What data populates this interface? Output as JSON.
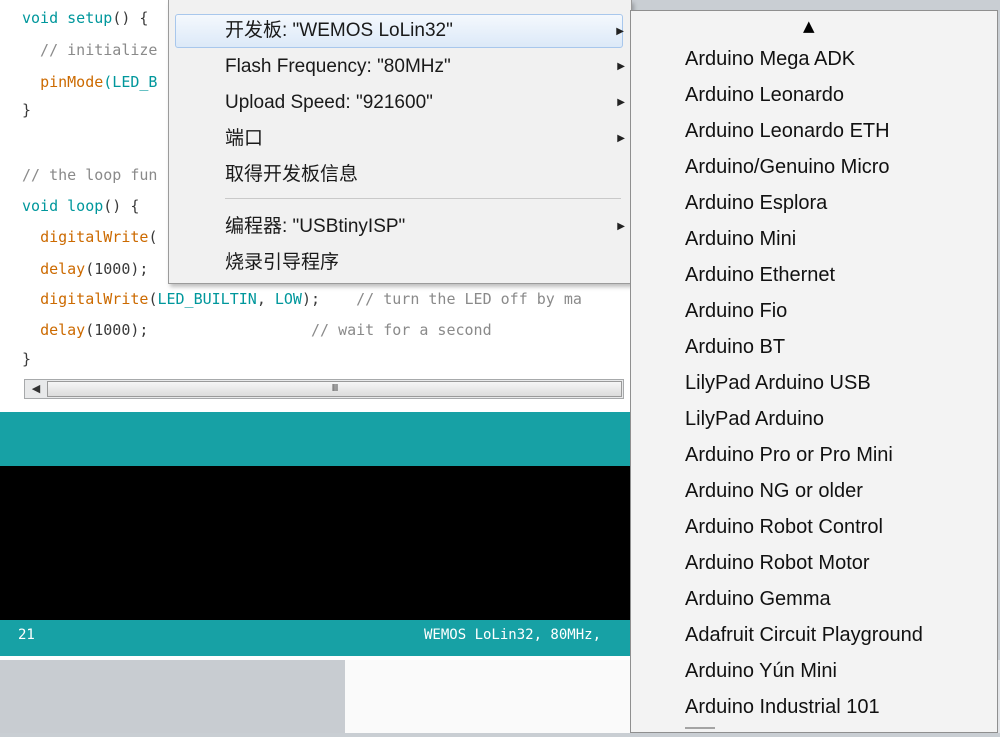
{
  "editor": {
    "lines": [
      {
        "parts": [
          {
            "t": "void ",
            "c": "kw"
          },
          {
            "t": "setup",
            "c": "kw"
          },
          {
            "t": "() {",
            "c": ""
          }
        ]
      },
      {
        "parts": [
          {
            "t": "  // initialize",
            "c": "cm"
          }
        ]
      },
      {
        "parts": [
          {
            "t": "  ",
            "c": ""
          },
          {
            "t": "pinMode",
            "c": "fn"
          },
          {
            "t": "(LED_B",
            "c": "kw"
          }
        ]
      },
      {
        "parts": [
          {
            "t": "}",
            "c": ""
          }
        ]
      },
      {
        "parts": [
          {
            "t": "",
            "c": ""
          }
        ]
      },
      {
        "parts": [
          {
            "t": "// the loop fun",
            "c": "cm"
          }
        ]
      },
      {
        "parts": [
          {
            "t": "void ",
            "c": "kw"
          },
          {
            "t": "loop",
            "c": "kw"
          },
          {
            "t": "() {",
            "c": ""
          }
        ]
      },
      {
        "parts": [
          {
            "t": "  ",
            "c": ""
          },
          {
            "t": "digitalWrite",
            "c": "fn"
          },
          {
            "t": "(",
            "c": ""
          }
        ]
      },
      {
        "parts": [
          {
            "t": "  ",
            "c": ""
          },
          {
            "t": "delay",
            "c": "fn"
          },
          {
            "t": "(1000);",
            "c": ""
          }
        ]
      },
      {
        "parts": [
          {
            "t": "  ",
            "c": ""
          },
          {
            "t": "digitalWrite",
            "c": "fn"
          },
          {
            "t": "(",
            "c": ""
          },
          {
            "t": "LED_BUILTIN",
            "c": "kw"
          },
          {
            "t": ", ",
            "c": ""
          },
          {
            "t": "LOW",
            "c": "kw"
          },
          {
            "t": ");    ",
            "c": ""
          },
          {
            "t": "// turn the LED off by ma",
            "c": "cm"
          }
        ]
      },
      {
        "parts": [
          {
            "t": "  ",
            "c": ""
          },
          {
            "t": "delay",
            "c": "fn"
          },
          {
            "t": "(1000);",
            "c": ""
          },
          {
            "t": "                  // wait for a second",
            "c": "cm"
          }
        ]
      },
      {
        "parts": [
          {
            "t": "}",
            "c": ""
          }
        ]
      }
    ],
    "scrollbar_thumb_grip": "III",
    "scroll_left_arrow": "◀"
  },
  "footer": {
    "line_number": "21",
    "board_info": "WEMOS LoLin32, 80MHz,"
  },
  "tools_menu": {
    "items": [
      {
        "label": "开发板: \"WEMOS LoLin32\"",
        "submenu": true,
        "highlighted": true
      },
      {
        "label": "Flash Frequency: \"80MHz\"",
        "submenu": true
      },
      {
        "label": "Upload Speed: \"921600\"",
        "submenu": true
      },
      {
        "label": "端口",
        "submenu": true
      },
      {
        "label": "取得开发板信息",
        "submenu": false
      },
      {
        "label": "编程器: \"USBtinyISP\"",
        "submenu": true
      },
      {
        "label": "烧录引导程序",
        "submenu": false
      }
    ],
    "arrow_glyph": "▶"
  },
  "board_menu": {
    "scroll_up_glyph": "▲",
    "items": [
      "Arduino Mega ADK",
      "Arduino Leonardo",
      "Arduino Leonardo ETH",
      "Arduino/Genuino Micro",
      "Arduino Esplora",
      "Arduino Mini",
      "Arduino Ethernet",
      "Arduino Fio",
      "Arduino BT",
      "LilyPad Arduino USB",
      "LilyPad Arduino",
      "Arduino Pro or Pro Mini",
      "Arduino NG or older",
      "Arduino Robot Control",
      "Arduino Robot Motor",
      "Arduino Gemma",
      "Adafruit Circuit Playground",
      "Arduino Yún Mini",
      "Arduino Industrial 101"
    ]
  },
  "colors": {
    "teal": "#17a1a5",
    "menu_highlight": "#dce9f8"
  }
}
